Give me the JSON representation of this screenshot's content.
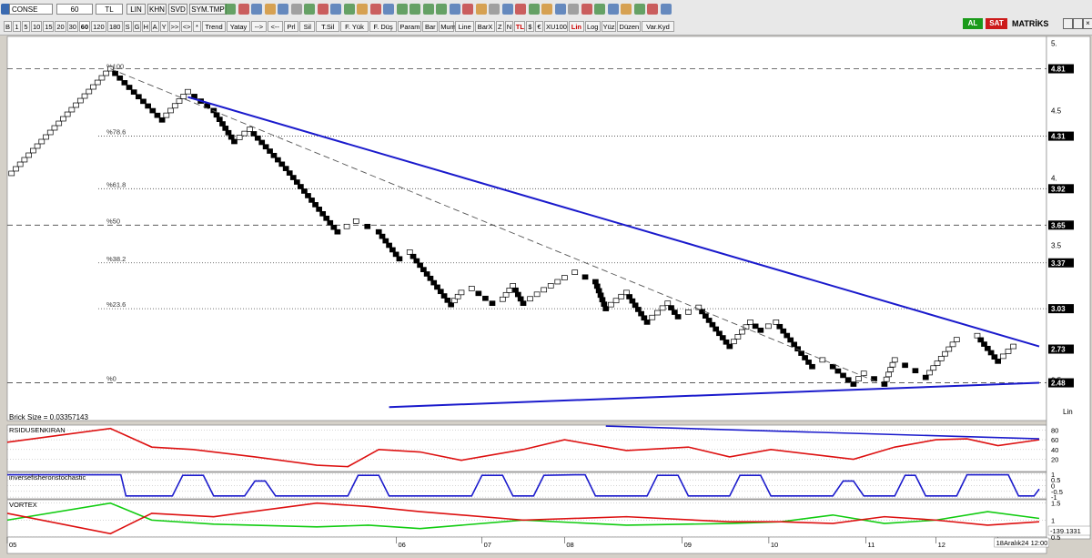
{
  "toolbar": {
    "symbol": "CONSE",
    "period": "60",
    "currency": "TL",
    "menu_items": [
      "LIN",
      "KHN",
      "SVD",
      "SYM.TMP"
    ],
    "buttons": [
      "B",
      "1",
      "5",
      "10",
      "15",
      "20",
      "30",
      "60",
      "120",
      "180",
      "S",
      "G",
      "H",
      "A",
      "Y",
      ">>",
      "<>",
      "*",
      "Trend",
      "Yatay",
      "-->",
      "<--",
      "Prl",
      "Sil",
      "T.Sil",
      "F. Yük",
      "F. Düş",
      "Param",
      "Bar",
      "Mum",
      "Line",
      "BarX",
      "Z",
      "N",
      "TL",
      "$",
      "€",
      "XU100",
      "Lin",
      "Log",
      "Yüz",
      "Düzen",
      "Var.Kyd"
    ],
    "selected_button": "60",
    "red_buttons": [
      "TL",
      "Lin"
    ],
    "al_label": "AL",
    "sat_label": "SAT",
    "brand": "MATRİKS",
    "accent_green": "#1a9a1a",
    "accent_red": "#cc1a1a"
  },
  "main_panel": {
    "brick_size_label": "Brick Size = 0.03357143",
    "scale_mode": "Lin"
  },
  "chart_data": [
    {
      "type": "renko",
      "brick_size": 0.03357143,
      "ylim": [
        2.2,
        5.05
      ],
      "y_ticks": [
        "5.",
        "4.5",
        "4.",
        "3.5",
        "2.5"
      ],
      "y_tick_values": [
        5.0,
        4.5,
        4.0,
        3.5,
        2.5
      ],
      "price_labels": [
        {
          "label": "4.81",
          "value": 4.81,
          "line": "dashed"
        },
        {
          "label": "4.31",
          "value": 4.31,
          "line": "dotted"
        },
        {
          "label": "3.92",
          "value": 3.92,
          "line": "dotted"
        },
        {
          "label": "3.65",
          "value": 3.65,
          "line": "dashed"
        },
        {
          "label": "3.37",
          "value": 3.37,
          "line": "dotted"
        },
        {
          "label": "3.03",
          "value": 3.03,
          "line": "dotted"
        },
        {
          "label": "2.73",
          "value": 2.73,
          "line": "none"
        },
        {
          "label": "2.48",
          "value": 2.48,
          "line": "dashed"
        }
      ],
      "fib_labels": [
        {
          "label": "%100",
          "value": 4.81
        },
        {
          "label": "%78.6",
          "value": 4.31
        },
        {
          "label": "%61.8",
          "value": 3.92
        },
        {
          "label": "%50",
          "value": 3.65
        },
        {
          "label": "%38.2",
          "value": 3.37
        },
        {
          "label": "%23.6",
          "value": 3.03
        },
        {
          "label": "%0",
          "value": 2.48
        }
      ],
      "x_labels": [
        {
          "label": "05",
          "pos": 0.0
        },
        {
          "label": "06",
          "pos": 0.377
        },
        {
          "label": "07",
          "pos": 0.46
        },
        {
          "label": "08",
          "pos": 0.54
        },
        {
          "label": "09",
          "pos": 0.654
        },
        {
          "label": "10",
          "pos": 0.738
        },
        {
          "label": "11",
          "pos": 0.832
        },
        {
          "label": "12",
          "pos": 0.9
        },
        {
          "label": "18Aralık24 12:00",
          "pos": 0.96
        }
      ],
      "price_path": [
        [
          0.0,
          4.0
        ],
        [
          0.1,
          4.81
        ],
        [
          0.15,
          4.43
        ],
        [
          0.175,
          4.64
        ],
        [
          0.2,
          4.5
        ],
        [
          0.22,
          4.27
        ],
        [
          0.235,
          4.36
        ],
        [
          0.27,
          4.07
        ],
        [
          0.32,
          3.6
        ],
        [
          0.338,
          3.68
        ],
        [
          0.36,
          3.6
        ],
        [
          0.38,
          3.4
        ],
        [
          0.39,
          3.45
        ],
        [
          0.43,
          3.06
        ],
        [
          0.44,
          3.15
        ],
        [
          0.45,
          3.18
        ],
        [
          0.47,
          3.07
        ],
        [
          0.48,
          3.1
        ],
        [
          0.49,
          3.2
        ],
        [
          0.5,
          3.07
        ],
        [
          0.52,
          3.17
        ],
        [
          0.54,
          3.26
        ],
        [
          0.55,
          3.3
        ],
        [
          0.57,
          3.23
        ],
        [
          0.58,
          3.03
        ],
        [
          0.6,
          3.15
        ],
        [
          0.62,
          2.93
        ],
        [
          0.64,
          3.07
        ],
        [
          0.65,
          2.97
        ],
        [
          0.67,
          3.04
        ],
        [
          0.7,
          2.75
        ],
        [
          0.72,
          2.93
        ],
        [
          0.73,
          2.87
        ],
        [
          0.745,
          2.93
        ],
        [
          0.78,
          2.6
        ],
        [
          0.79,
          2.65
        ],
        [
          0.8,
          2.6
        ],
        [
          0.82,
          2.47
        ],
        [
          0.83,
          2.55
        ],
        [
          0.85,
          2.47
        ],
        [
          0.86,
          2.65
        ],
        [
          0.88,
          2.57
        ],
        [
          0.89,
          2.52
        ],
        [
          0.92,
          2.8
        ],
        [
          0.94,
          2.83
        ],
        [
          0.96,
          2.64
        ],
        [
          0.975,
          2.75
        ]
      ],
      "overlays": [
        {
          "name": "downtrend",
          "color": "#1a1acc",
          "from": [
            0.175,
            4.6
          ],
          "to": [
            1.0,
            2.75
          ]
        },
        {
          "name": "support",
          "color": "#1a1acc",
          "from": [
            0.37,
            2.3
          ],
          "to": [
            1.0,
            2.48
          ]
        },
        {
          "name": "dashed-trend",
          "color": "#555555",
          "from": [
            0.1,
            4.81
          ],
          "to": [
            0.845,
            2.48
          ]
        }
      ]
    },
    {
      "type": "line",
      "title": "RSIDUSENKIRAN",
      "ylim": [
        -5,
        90
      ],
      "y_ticks": [
        "80",
        "60",
        "40",
        "20"
      ],
      "y_tick_values": [
        80,
        60,
        40,
        20
      ],
      "series": [
        {
          "color": "#dd1111",
          "values": [
            [
              0,
              55
            ],
            [
              0.1,
              83
            ],
            [
              0.14,
              45
            ],
            [
              0.18,
              40
            ],
            [
              0.24,
              25
            ],
            [
              0.3,
              8
            ],
            [
              0.33,
              5
            ],
            [
              0.36,
              40
            ],
            [
              0.4,
              35
            ],
            [
              0.44,
              18
            ],
            [
              0.5,
              40
            ],
            [
              0.54,
              60
            ],
            [
              0.6,
              38
            ],
            [
              0.66,
              45
            ],
            [
              0.7,
              25
            ],
            [
              0.74,
              40
            ],
            [
              0.78,
              30
            ],
            [
              0.82,
              20
            ],
            [
              0.86,
              45
            ],
            [
              0.9,
              60
            ],
            [
              0.93,
              62
            ],
            [
              0.96,
              48
            ],
            [
              1,
              60
            ]
          ]
        },
        {
          "color": "#1a1acc",
          "values": [
            [
              0.58,
              88
            ],
            [
              1,
              62
            ]
          ]
        }
      ]
    },
    {
      "type": "line",
      "title": "inversefisheronstochastic",
      "ylim": [
        -1.15,
        1.15
      ],
      "y_ticks": [
        "1",
        "0.5",
        "0",
        "-0.5",
        "-1"
      ],
      "y_tick_values": [
        1,
        0.5,
        0,
        -0.5,
        -1
      ],
      "series": [
        {
          "color": "#1a1acc",
          "values": [
            [
              0,
              0.95
            ],
            [
              0.11,
              0.95
            ],
            [
              0.115,
              -0.9
            ],
            [
              0.16,
              -0.9
            ],
            [
              0.17,
              0.9
            ],
            [
              0.19,
              0.9
            ],
            [
              0.2,
              -0.9
            ],
            [
              0.23,
              -0.9
            ],
            [
              0.24,
              0.4
            ],
            [
              0.25,
              0.4
            ],
            [
              0.26,
              -0.9
            ],
            [
              0.33,
              -0.9
            ],
            [
              0.34,
              0.9
            ],
            [
              0.36,
              0.9
            ],
            [
              0.37,
              -0.9
            ],
            [
              0.45,
              -0.9
            ],
            [
              0.46,
              0.9
            ],
            [
              0.48,
              0.9
            ],
            [
              0.49,
              -0.9
            ],
            [
              0.51,
              -0.9
            ],
            [
              0.52,
              0.9
            ],
            [
              0.55,
              0.95
            ],
            [
              0.56,
              0.95
            ],
            [
              0.57,
              -0.9
            ],
            [
              0.62,
              -0.9
            ],
            [
              0.63,
              0.9
            ],
            [
              0.65,
              0.9
            ],
            [
              0.66,
              -0.9
            ],
            [
              0.7,
              -0.9
            ],
            [
              0.71,
              0.9
            ],
            [
              0.73,
              0.9
            ],
            [
              0.74,
              -0.9
            ],
            [
              0.8,
              -0.9
            ],
            [
              0.81,
              0.4
            ],
            [
              0.82,
              0.4
            ],
            [
              0.83,
              -0.9
            ],
            [
              0.86,
              -0.9
            ],
            [
              0.87,
              0.9
            ],
            [
              0.88,
              0.9
            ],
            [
              0.89,
              -0.9
            ],
            [
              0.92,
              -0.9
            ],
            [
              0.93,
              0.95
            ],
            [
              0.97,
              0.95
            ],
            [
              0.98,
              -0.9
            ],
            [
              0.995,
              -0.9
            ],
            [
              1,
              -0.3
            ]
          ]
        }
      ]
    },
    {
      "type": "line",
      "title": "VORTEX",
      "ylim": [
        0.5,
        1.6
      ],
      "y_ticks": [
        "1.5",
        "1",
        "0.5"
      ],
      "y_tick_values": [
        1.5,
        1.0,
        0.5
      ],
      "value_label": "-139.1331",
      "series": [
        {
          "color": "#11cc11",
          "values": [
            [
              0,
              1.0
            ],
            [
              0.1,
              1.5
            ],
            [
              0.14,
              1.0
            ],
            [
              0.2,
              0.88
            ],
            [
              0.3,
              0.8
            ],
            [
              0.35,
              0.85
            ],
            [
              0.4,
              0.75
            ],
            [
              0.5,
              1.0
            ],
            [
              0.6,
              0.85
            ],
            [
              0.7,
              0.9
            ],
            [
              0.75,
              0.95
            ],
            [
              0.8,
              1.15
            ],
            [
              0.85,
              0.9
            ],
            [
              0.9,
              1.0
            ],
            [
              0.95,
              1.25
            ],
            [
              1,
              1.05
            ]
          ]
        },
        {
          "color": "#dd1111",
          "values": [
            [
              0,
              1.2
            ],
            [
              0.1,
              0.6
            ],
            [
              0.14,
              1.2
            ],
            [
              0.2,
              1.1
            ],
            [
              0.3,
              1.5
            ],
            [
              0.35,
              1.4
            ],
            [
              0.4,
              1.25
            ],
            [
              0.5,
              1.0
            ],
            [
              0.6,
              1.1
            ],
            [
              0.7,
              0.95
            ],
            [
              0.75,
              0.95
            ],
            [
              0.8,
              0.9
            ],
            [
              0.85,
              1.1
            ],
            [
              0.9,
              1.0
            ],
            [
              0.95,
              0.85
            ],
            [
              1,
              0.95
            ]
          ]
        }
      ]
    }
  ]
}
